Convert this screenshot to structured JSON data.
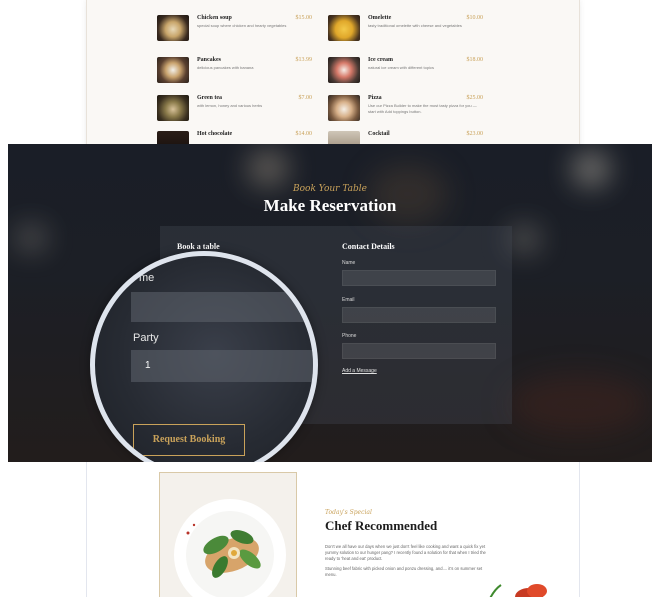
{
  "menu": {
    "items": [
      {
        "name": "Chicken soup",
        "desc": "special soup where chicken and hearty vegetables",
        "price": "$15.00"
      },
      {
        "name": "Omelette",
        "desc": "tasty traditional omelette with cheese and vegetables",
        "price": "$10.00"
      },
      {
        "name": "Pancakes",
        "desc": "delicious pancakes with banana",
        "price": "$13.99"
      },
      {
        "name": "Ice cream",
        "desc": "natural ice cream with different topics",
        "price": "$18.00"
      },
      {
        "name": "Green tea",
        "desc": "with lemon, honey and various herbs",
        "price": "$7.00"
      },
      {
        "name": "Pizza",
        "desc": "Use our Pizza Builder to make the most tasty pizza for you —start with Add toppings button.",
        "price": "$25.00"
      },
      {
        "name": "Hot chocolate",
        "desc": "",
        "price": "$14.00"
      },
      {
        "name": "Cocktail",
        "desc": "",
        "price": "$23.00"
      }
    ]
  },
  "reservation": {
    "cursive": "Book Your Table",
    "title": "Make Reservation",
    "book_heading": "Book a table",
    "contact_heading": "Contact Details",
    "name_label": "Name",
    "email_label": "Email",
    "phone_label": "Phone",
    "add_message": "Add a Message",
    "magnified": {
      "partial_label": "me",
      "party_label": "Party",
      "party_value": "1",
      "button": "Request Booking"
    }
  },
  "chef": {
    "cursive": "Today's Special",
    "title": "Chef Recommended",
    "para1": "Don't we all have our days when we just don't feel like cooking and want a quick fix yet yummy solution to our hunger pang? I recently found a solution for that when I tried the ready to 'heat and eat' product.",
    "para2": "Stunning beef fabric with picked onion and ponzu dressing, and.... it's on summer set menu."
  },
  "colors": {
    "accent_gold": "#c9a25a",
    "banner_dark": "#1c1f26"
  }
}
